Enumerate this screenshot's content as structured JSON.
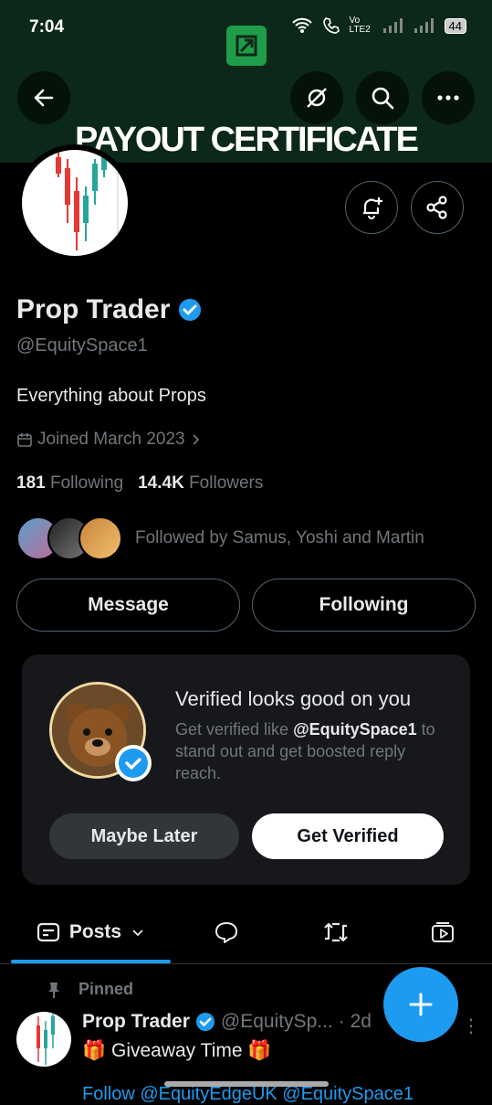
{
  "status_bar": {
    "time": "7:04",
    "battery": "44",
    "network": "Vo LTE2"
  },
  "banner": {
    "title": "PAYOUT CERTIFICATE"
  },
  "profile": {
    "name": "Prop Trader",
    "handle": "@EquitySpace1",
    "bio": "Everything about Props",
    "joined": "Joined March 2023",
    "following_count": "181",
    "following_label": "Following",
    "followers_count": "14.4K",
    "followers_label": "Followers",
    "followed_by": "Followed by Samus, Yoshi and Martin"
  },
  "actions": {
    "message": "Message",
    "following": "Following"
  },
  "verify_card": {
    "title": "Verified looks good on you",
    "line_prefix": "Get verified like ",
    "line_handle": "@EquitySpace1",
    "line_suffix": " to stand out and get boosted reply reach.",
    "maybe_later": "Maybe Later",
    "get_verified": "Get Verified"
  },
  "tabs": {
    "posts": "Posts"
  },
  "post": {
    "pinned_label": "Pinned",
    "author": "Prop Trader",
    "handle": "@EquitySp...",
    "age": "· 2d",
    "text": "🎁 Giveaway Time 🎁",
    "next_line": "Follow @EquityEdgeUK @EquitySpace1"
  },
  "colors": {
    "accent": "#1d9bf0",
    "background": "#000000",
    "card": "#16181c",
    "muted": "#71767b"
  }
}
